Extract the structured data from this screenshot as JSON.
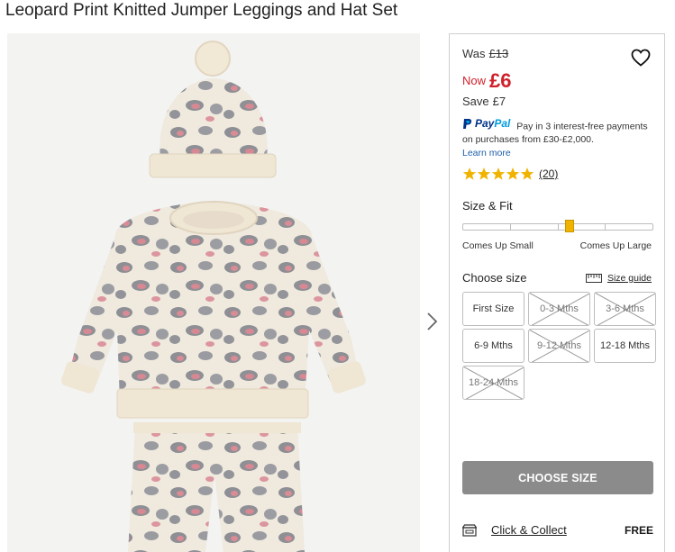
{
  "product": {
    "title": "Leopard Print Knitted Jumper Leggings and Hat Set"
  },
  "price": {
    "was_label": "Was",
    "was_value": "£13",
    "now_label": "Now",
    "now_value": "£6",
    "save_label": "Save",
    "save_value": "£7"
  },
  "paypal": {
    "logo_pay": "Pay",
    "logo_pal": "Pal",
    "text": "Pay in 3 interest-free payments on purchases from £30-£2,000.",
    "learn_more": "Learn more"
  },
  "rating": {
    "stars": 5,
    "count": "(20)"
  },
  "fit": {
    "label": "Size & Fit",
    "left_label": "Comes Up Small",
    "right_label": "Comes Up Large",
    "position": 0.5
  },
  "sizes": {
    "label": "Choose size",
    "guide_label": "Size guide",
    "options": [
      {
        "label": "First Size",
        "available": true
      },
      {
        "label": "0-3 Mths",
        "available": false
      },
      {
        "label": "3-6 Mths",
        "available": false
      },
      {
        "label": "6-9 Mths",
        "available": true
      },
      {
        "label": "9-12 Mths",
        "available": false
      },
      {
        "label": "12-18 Mths",
        "available": true
      },
      {
        "label": "18-24 Mths",
        "available": false
      }
    ]
  },
  "cta": {
    "label": "CHOOSE SIZE"
  },
  "delivery": {
    "option": "Click & Collect",
    "price": "FREE"
  },
  "colors": {
    "sale_red": "#d0202a",
    "button_grey": "#8b8b8b",
    "star_gold": "#f0b400",
    "link_blue": "#1f5fa8"
  }
}
